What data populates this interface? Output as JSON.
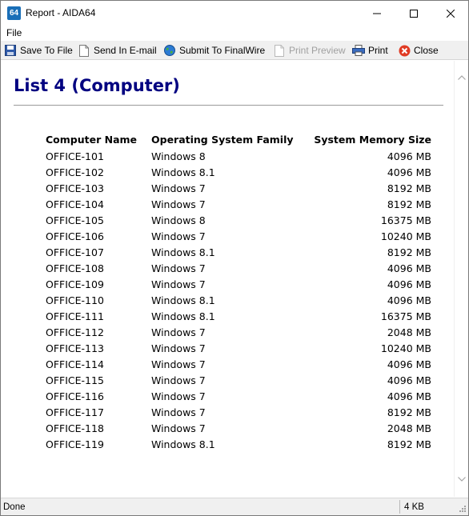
{
  "window": {
    "app_icon_text": "64",
    "title": "Report - AIDA64"
  },
  "menu": {
    "file": "File"
  },
  "toolbar": {
    "save_to_file": "Save To File",
    "send_email": "Send In E-mail",
    "submit": "Submit To FinalWire",
    "print_preview": "Print Preview",
    "print": "Print",
    "close": "Close"
  },
  "report": {
    "title": "List 4 (Computer)",
    "columns": [
      "Computer Name",
      "Operating System Family",
      "System Memory Size"
    ],
    "rows": [
      [
        "OFFICE-101",
        "Windows 8",
        "4096 MB"
      ],
      [
        "OFFICE-102",
        "Windows 8.1",
        "4096 MB"
      ],
      [
        "OFFICE-103",
        "Windows 7",
        "8192 MB"
      ],
      [
        "OFFICE-104",
        "Windows 7",
        "8192 MB"
      ],
      [
        "OFFICE-105",
        "Windows 8",
        "16375 MB"
      ],
      [
        "OFFICE-106",
        "Windows 7",
        "10240 MB"
      ],
      [
        "OFFICE-107",
        "Windows 8.1",
        "8192 MB"
      ],
      [
        "OFFICE-108",
        "Windows 7",
        "4096 MB"
      ],
      [
        "OFFICE-109",
        "Windows 7",
        "4096 MB"
      ],
      [
        "OFFICE-110",
        "Windows 8.1",
        "4096 MB"
      ],
      [
        "OFFICE-111",
        "Windows 8.1",
        "16375 MB"
      ],
      [
        "OFFICE-112",
        "Windows 7",
        "2048 MB"
      ],
      [
        "OFFICE-113",
        "Windows 7",
        "10240 MB"
      ],
      [
        "OFFICE-114",
        "Windows 7",
        "4096 MB"
      ],
      [
        "OFFICE-115",
        "Windows 7",
        "4096 MB"
      ],
      [
        "OFFICE-116",
        "Windows 7",
        "4096 MB"
      ],
      [
        "OFFICE-117",
        "Windows 7",
        "8192 MB"
      ],
      [
        "OFFICE-118",
        "Windows 7",
        "2048 MB"
      ],
      [
        "OFFICE-119",
        "Windows 8.1",
        "8192 MB"
      ]
    ]
  },
  "status": {
    "left": "Done",
    "right": "4 KB"
  },
  "colors": {
    "title_text": "#000080",
    "app_icon": "#1a6fb8",
    "close_icon": "#e03b24"
  },
  "icons": {
    "save": "floppy-disk-icon",
    "email": "document-icon",
    "submit": "globe-icon",
    "preview": "document-icon",
    "print": "printer-icon",
    "close": "close-circle-icon"
  }
}
